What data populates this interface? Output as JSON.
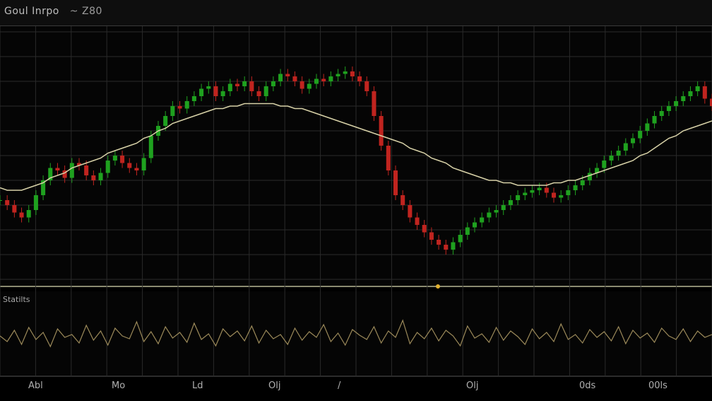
{
  "header": {
    "title": "Goul Inrpo",
    "timeframe": "~ Z80"
  },
  "volume_panel": {
    "label": "Statilts"
  },
  "x_axis": {
    "labels": [
      "Abl",
      "Mo",
      "Ld",
      "Olj",
      "/",
      "Olj",
      "0ds",
      "00ls"
    ]
  },
  "colors": {
    "up": "#1fa11f",
    "down": "#c0241f",
    "ma": "#d8d2a8",
    "grid": "#2a2a2a",
    "oscillator": "#9c8a5a"
  },
  "chart_data": {
    "type": "line",
    "title": "",
    "xlabel": "",
    "ylabel": "",
    "ylim": [
      0,
      100
    ],
    "grid": true,
    "legend": "none",
    "x": [
      0,
      1,
      2,
      3,
      4,
      5,
      6,
      7,
      8,
      9,
      10,
      11,
      12,
      13,
      14,
      15,
      16,
      17,
      18,
      19,
      20,
      21,
      22,
      23,
      24,
      25,
      26,
      27,
      28,
      29,
      30,
      31,
      32,
      33,
      34,
      35,
      36,
      37,
      38,
      39,
      40,
      41,
      42,
      43,
      44,
      45,
      46,
      47,
      48,
      49,
      50,
      51,
      52,
      53,
      54,
      55,
      56,
      57,
      58,
      59,
      60,
      61,
      62,
      63,
      64,
      65,
      66,
      67,
      68,
      69,
      70,
      71,
      72,
      73,
      74,
      75,
      76,
      77,
      78,
      79,
      80,
      81,
      82,
      83,
      84,
      85,
      86,
      87,
      88,
      89,
      90,
      91,
      92,
      93,
      94,
      95,
      96,
      97,
      98,
      99
    ],
    "series": [
      {
        "name": "",
        "kind": "price",
        "values": [
          32,
          30,
          27,
          25,
          28,
          34,
          40,
          45,
          44,
          41,
          47,
          46,
          42,
          40,
          43,
          48,
          50,
          47,
          45,
          44,
          49,
          58,
          62,
          66,
          70,
          69,
          72,
          74,
          77,
          78,
          74,
          76,
          79,
          78,
          80,
          76,
          74,
          78,
          80,
          83,
          82,
          80,
          77,
          79,
          81,
          80,
          82,
          83,
          84,
          82,
          80,
          76,
          66,
          54,
          44,
          34,
          30,
          25,
          22,
          19,
          16,
          14,
          12,
          15,
          18,
          21,
          23,
          25,
          27,
          28,
          30,
          32,
          34,
          35,
          36,
          37,
          35,
          33,
          34,
          36,
          38,
          40,
          43,
          45,
          48,
          50,
          52,
          55,
          57,
          60,
          63,
          66,
          68,
          70,
          72,
          74,
          76,
          78,
          73,
          70
        ]
      },
      {
        "name": "",
        "kind": "moving-average",
        "values": [
          37,
          36,
          36,
          36,
          37,
          38,
          39,
          41,
          42,
          43,
          45,
          46,
          47,
          48,
          49,
          51,
          52,
          53,
          54,
          55,
          57,
          58,
          60,
          61,
          63,
          64,
          65,
          66,
          67,
          68,
          69,
          69,
          70,
          70,
          71,
          71,
          71,
          71,
          71,
          70,
          70,
          69,
          69,
          68,
          67,
          66,
          65,
          64,
          63,
          62,
          61,
          60,
          59,
          58,
          57,
          56,
          55,
          53,
          52,
          51,
          49,
          48,
          47,
          45,
          44,
          43,
          42,
          41,
          40,
          40,
          39,
          39,
          38,
          38,
          38,
          38,
          38,
          39,
          39,
          40,
          40,
          41,
          42,
          43,
          44,
          45,
          46,
          47,
          48,
          50,
          51,
          53,
          55,
          57,
          58,
          60,
          61,
          62,
          63,
          64
        ]
      },
      {
        "name": "",
        "kind": "oscillator",
        "values": [
          50,
          42,
          58,
          38,
          62,
          45,
          55,
          35,
          60,
          48,
          52,
          40,
          65,
          44,
          57,
          37,
          61,
          50,
          46,
          70,
          42,
          56,
          39,
          63,
          47,
          55,
          41,
          68,
          45,
          53,
          36,
          60,
          49,
          57,
          43,
          64,
          40,
          58,
          46,
          52,
          38,
          61,
          44,
          56,
          48,
          66,
          42,
          54,
          37,
          59,
          51,
          45,
          63,
          40,
          57,
          48,
          72,
          39,
          55,
          46,
          61,
          43,
          58,
          50,
          36,
          64,
          47,
          53,
          41,
          62,
          44,
          57,
          49,
          38,
          60,
          46,
          55,
          42,
          67,
          45,
          52,
          40,
          59,
          48,
          56,
          43,
          63,
          39,
          58,
          47,
          54,
          41,
          61,
          50,
          45,
          60,
          42,
          57,
          48,
          52
        ]
      }
    ]
  }
}
